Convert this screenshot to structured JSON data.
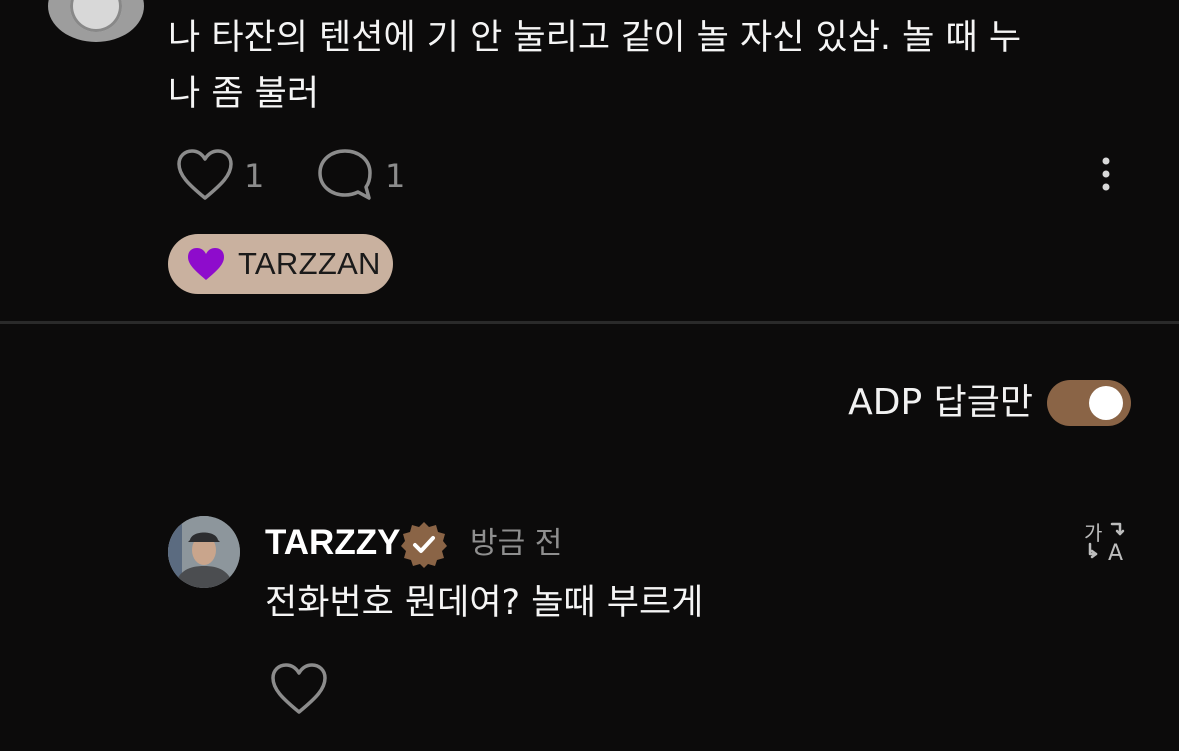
{
  "comment": {
    "text": "나 타잔의 텐션에 기 안 눌리고 같이 놀 자신 있삼. 놀 때 누나 좀 불러",
    "like_count": "1",
    "reply_count": "1",
    "badge": {
      "label": "TARZZAN",
      "heart_color": "#8e0ccc",
      "background": "#c9b19f"
    }
  },
  "filter": {
    "label": "ADP 답글만",
    "toggle_on": true,
    "toggle_color": "#8a6446"
  },
  "reply": {
    "username": "TARZZY",
    "verified_badge_color": "#8a6446",
    "timestamp": "방금 전",
    "text": "전화번호 뭔데여? 놀때 부르게",
    "icons": {
      "translate": "translate-icon",
      "like": "heart-outline-icon"
    }
  }
}
